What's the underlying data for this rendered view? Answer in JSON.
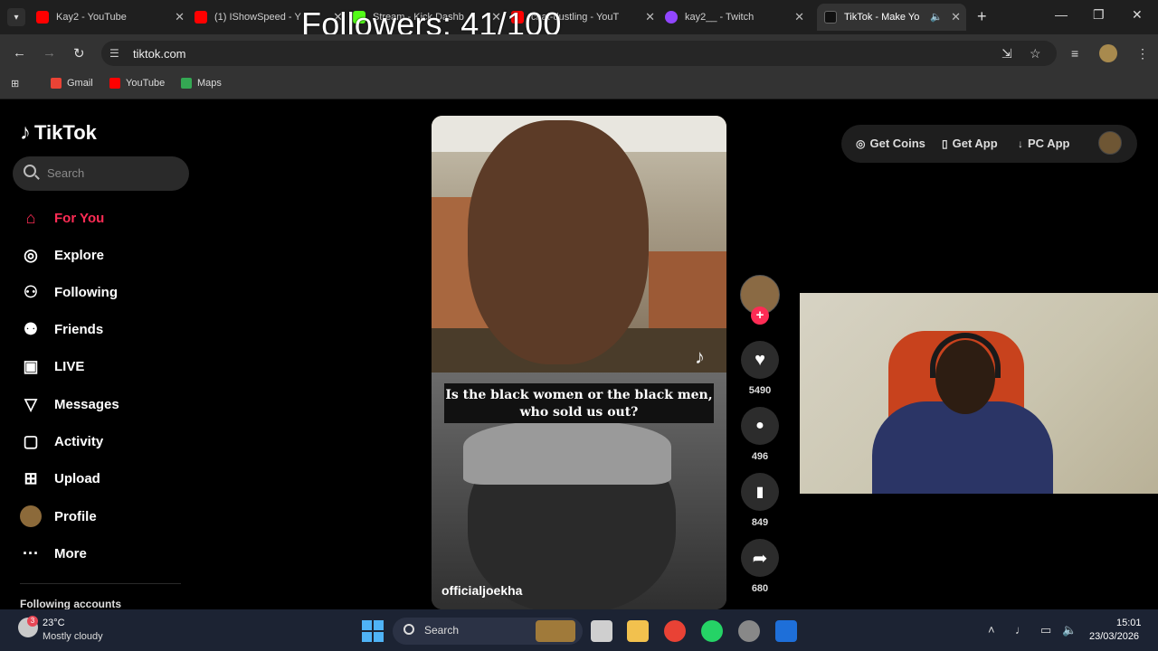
{
  "overlay": {
    "followers_text": "Followers: 41/100"
  },
  "browser": {
    "tabs": [
      {
        "title": "Kay2 - YouTube",
        "icon": "youtube-icon"
      },
      {
        "title": "(1) IShowSpeed - Y",
        "icon": "youtube-icon"
      },
      {
        "title": "Stream - Kick Dashb",
        "icon": "kick-icon"
      },
      {
        "title": "chat-dustling - YouT",
        "icon": "youtube-icon"
      },
      {
        "title": "kay2__ - Twitch",
        "icon": "twitch-icon"
      },
      {
        "title": "TikTok - Make Yo",
        "icon": "tiktok-icon",
        "active": true
      }
    ],
    "url": "tiktok.com",
    "bookmarks": [
      {
        "label": "Gmail",
        "color": "#ea4335"
      },
      {
        "label": "YouTube",
        "color": "#ff0000"
      },
      {
        "label": "Maps",
        "color": "#34a853"
      }
    ]
  },
  "tiktok": {
    "brand": "TikTok",
    "search_placeholder": "Search",
    "nav": [
      {
        "label": "For You",
        "icon": "home-icon",
        "active": true
      },
      {
        "label": "Explore",
        "icon": "compass-icon"
      },
      {
        "label": "Following",
        "icon": "user-follow-icon"
      },
      {
        "label": "Friends",
        "icon": "friends-icon"
      },
      {
        "label": "LIVE",
        "icon": "live-icon"
      },
      {
        "label": "Messages",
        "icon": "send-icon"
      },
      {
        "label": "Activity",
        "icon": "activity-icon"
      },
      {
        "label": "Upload",
        "icon": "upload-icon"
      },
      {
        "label": "Profile",
        "icon": "avatar"
      },
      {
        "label": "More",
        "icon": "more-icon"
      }
    ],
    "following_accounts": "Following accounts",
    "header": {
      "get_coins": "Get Coins",
      "get_app": "Get App",
      "pc_app": "PC App"
    },
    "video": {
      "caption": "Is the black women or the black men, who sold us out?",
      "author": "officialjoekha"
    },
    "actions": {
      "likes": "5490",
      "comments": "496",
      "saves": "849",
      "shares": "680"
    },
    "accent": "#fe2c55"
  },
  "taskbar": {
    "weather_temp": "23°C",
    "weather_desc": "Mostly cloudy",
    "weather_badge": "3",
    "search": "Search",
    "time": "15:01",
    "date": "23/03/2026"
  }
}
